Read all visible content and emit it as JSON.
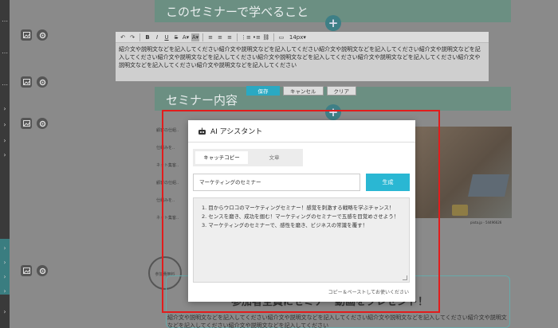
{
  "background": {
    "section1_title": "このセミナーで学べること",
    "section2_title": "セミナー内容",
    "plus_symbol": "+",
    "list_items": [
      "顧客の仕組..",
      "仕組みを..",
      "ネット集客..",
      "顧客の仕組..",
      "仕組みを..",
      "ネット集客.."
    ],
    "photo_caption": "pixta.jp - 54496626",
    "badge_label": "参加費無料",
    "promo_title": "参加者全員にセミナー動画をプレゼント！",
    "promo_text": "紹介文や説明文などを記入してください紹介文や説明文などを記入してください紹介文や説明文などを記入してください紹介文や説明文などを記入してください紹介文や説明文などを記入してください"
  },
  "editor": {
    "font_size": "14px",
    "content": "紹介文や説明文などを記入してください紹介文や説明文などを記入してください紹介文や説明文などを記入してください紹介文や説明文などを記入してください紹介文や説明文などを記入してください紹介文や説明文などを記入してください紹介文や説明文などを記入してください紹介文や説明文などを記入してください紹介文や説明文などを記入してください",
    "save_label": "保存",
    "cancel_label": "キャンセル",
    "clear_label": "クリア"
  },
  "modal": {
    "title": "AI アシスタント",
    "tabs": [
      "キャッチコピー",
      "文章"
    ],
    "keyword_value": "マーケティングのセミナー",
    "generate_label": "生成",
    "results": [
      "1. 目からウロコのマーケティングセミナー！感覚を刺激する戦略を学ぶチャンス！",
      "2. センスを磨き、成功を掴む！マーケティングのセミナーで五感を目覚めさせよう！",
      "3. マーケティングのセミナーで、感性を磨き、ビジネスの常識を覆す！"
    ],
    "hint": "コピー＆ペーストしてお使いください"
  },
  "colors": {
    "accent": "#2ab7d3",
    "highlight_frame": "#e21c1c",
    "section_bar": "#6b8f82"
  }
}
